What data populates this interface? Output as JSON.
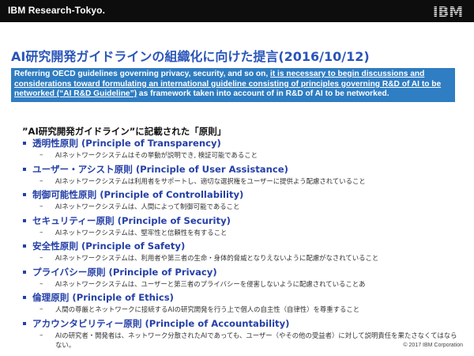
{
  "header": {
    "org_label": "IBM Research-Tokyo.",
    "logo_text": "IBM"
  },
  "slide": {
    "title": "AI研究開発ガイドラインの組織化に向けた提言(2016/10/12)",
    "callout": {
      "part1": "Referring OECD guidelines governing privacy, security, and so on, ",
      "part2": "it is necessary to begin discussions and considerations toward formulating an international guideline consisting of principles governing R&D of AI to be networked (“AI R&D Guideline”)",
      "part3": " as framework taken into account of in R&D of AI to be networked."
    },
    "section_title": "”AI研究開発ガイドライン”に記載された「原則」",
    "principles": [
      {
        "label": "透明性原則 (Principle of Transparency)",
        "desc": "AIネットワークシステムはその挙動が説明でき, 検証可能であること"
      },
      {
        "label": "ユーザー・アシスト原則 (Principle of User Assistance)",
        "desc": "AIネットワークシステムは利用者をサポートし、適切な選択権をユーザーに提供よう配慮されていること"
      },
      {
        "label": "制御可能性原則 (Principle of Controllability)",
        "desc": "AIネットワークシステムは、人間によって制御可能であること"
      },
      {
        "label": "セキュリティー原則 (Principle of Security)",
        "desc": "AIネットワークシステムは、堅牢性と信頼性を有すること"
      },
      {
        "label": "安全性原則 (Principle of Safety)",
        "desc": "AIネットワークシステムは、利用者や第三者の生命・身体的脅威となりえないように配慮がなされていること"
      },
      {
        "label": "プライバシー原則 (Principle of Privacy)",
        "desc": "AIネットワークシステムは、ユーザーと第三者のプライバシーを侵害しないように配慮されていることあ"
      },
      {
        "label": "倫理原則 (Principle of Ethics)",
        "desc": "人間の尊厳とネットワークに接続するAIの研究開発を行う上で個人の自主性（自律性）を尊重すること"
      },
      {
        "label": "アカウンタビリティー原則 (Principle of Accountability)",
        "desc": "AIの研究者・開発者は、ネットワーク分散されたAIであっても、ユーザー（やその他の受益者）に対して説明責任を果たさなくてはならない。"
      }
    ]
  },
  "footer": {
    "copyright": "© 2017 IBM Corporation"
  },
  "colors": {
    "topbar": "#0d0d0d",
    "title": "#2a55b8",
    "callout_bg": "#2f7dc2",
    "principle": "#2540a8"
  }
}
